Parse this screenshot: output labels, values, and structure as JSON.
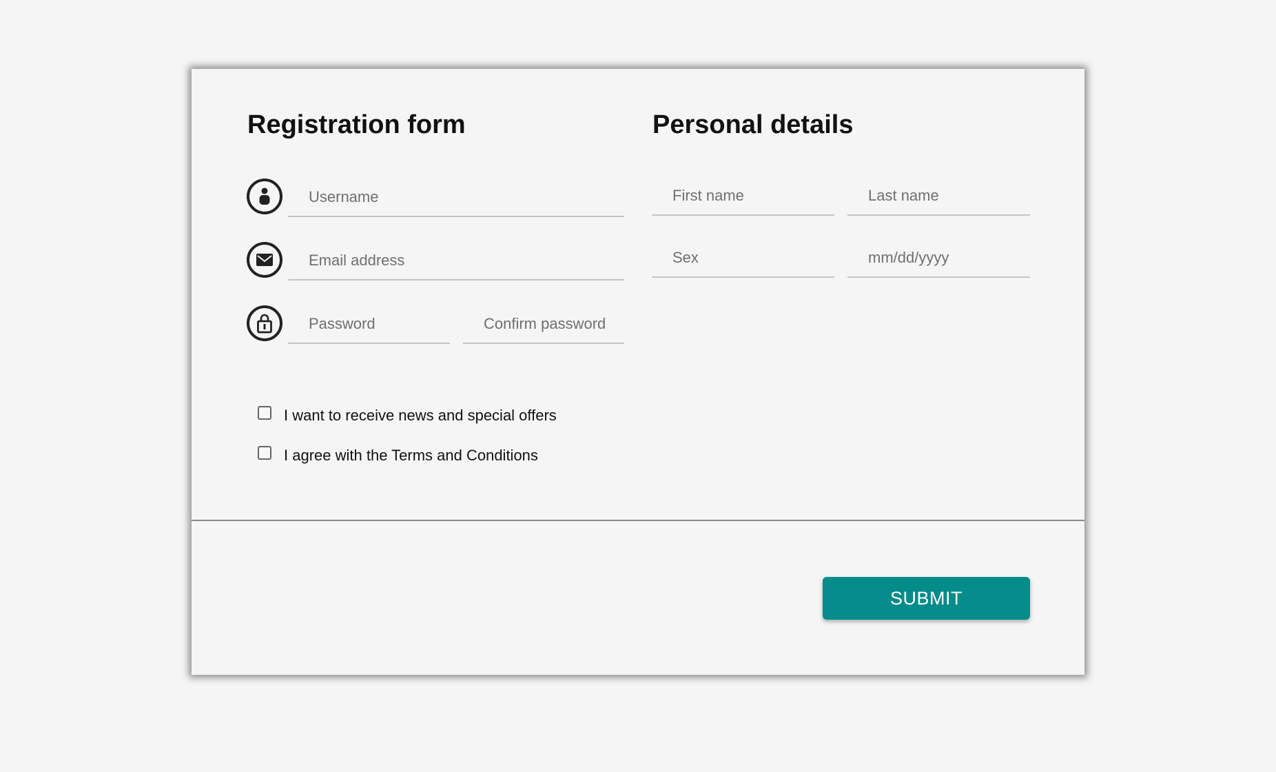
{
  "registration": {
    "title": "Registration form",
    "username_placeholder": "Username",
    "email_placeholder": "Email address",
    "password_placeholder": "Password",
    "confirm_password_placeholder": "Confirm password"
  },
  "personal": {
    "title": "Personal details",
    "first_name_placeholder": "First name",
    "last_name_placeholder": "Last name",
    "sex_placeholder": "Sex",
    "date_placeholder": "mm/dd/yyyy"
  },
  "checkboxes": [
    {
      "label": "I want to receive news and special offers",
      "checked": false
    },
    {
      "label": "I agree with the Terms and Conditions",
      "checked": false
    }
  ],
  "submit_label": "SUBMIT",
  "icons": [
    "user-icon",
    "envelope-icon",
    "lock-icon"
  ],
  "colors": {
    "accent": "#038c8a",
    "background": "#f5f5f5",
    "field_underline": "#c4c4c4"
  }
}
